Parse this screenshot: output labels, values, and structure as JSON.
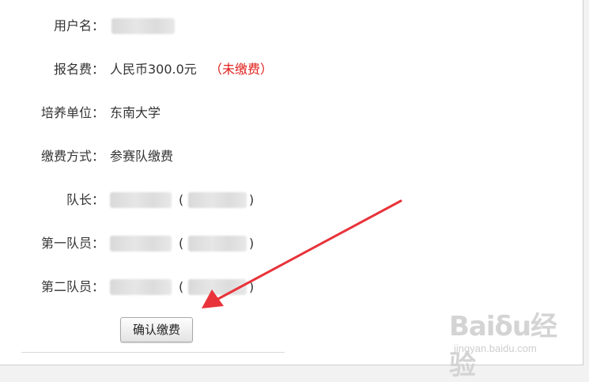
{
  "form": {
    "rows": [
      {
        "label": "用户名："
      },
      {
        "label": "报名费：",
        "amount": "人民币300.0元",
        "status": "（未缴费）"
      },
      {
        "label": "培养单位：",
        "value": "东南大学"
      },
      {
        "label": "缴费方式：",
        "value": "参赛队缴费"
      },
      {
        "label": "队长："
      },
      {
        "label": "第一队员："
      },
      {
        "label": "第二队员："
      }
    ],
    "paren_open": "(",
    "paren_close": ")",
    "confirm_button": "确认缴费"
  },
  "colors": {
    "status_red": "#e0201c",
    "arrow_red": "#e8333a"
  },
  "watermark": {
    "logo_text": "Baiδu经验",
    "url": "jingyan.baidu.com",
    "icon": "baidu-paw-icon"
  }
}
